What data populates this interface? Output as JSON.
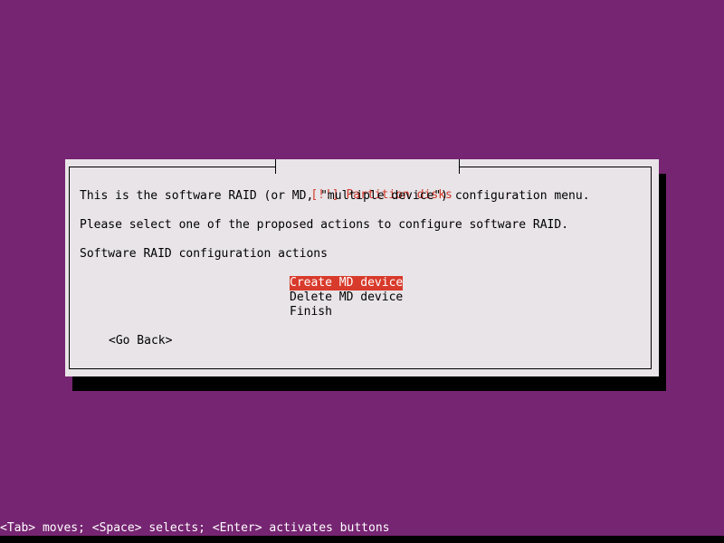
{
  "dialog": {
    "title": "[!!] Partition disks",
    "intro": "This is the software RAID (or MD, \"multiple device\") configuration menu.",
    "instruction": "Please select one of the proposed actions to configure software RAID.",
    "list_label": "Software RAID configuration actions",
    "actions": [
      {
        "label": "Create MD device",
        "selected": true
      },
      {
        "label": "Delete MD device",
        "selected": false
      },
      {
        "label": "Finish",
        "selected": false
      }
    ],
    "go_back_label": "<Go Back>"
  },
  "status_bar": {
    "help": "<Tab> moves; <Space> selects; <Enter> activates buttons"
  },
  "colors": {
    "background": "#762572",
    "dialog": "#e8e4e7",
    "title": "#d0392b",
    "selection": "#d83a2b"
  }
}
